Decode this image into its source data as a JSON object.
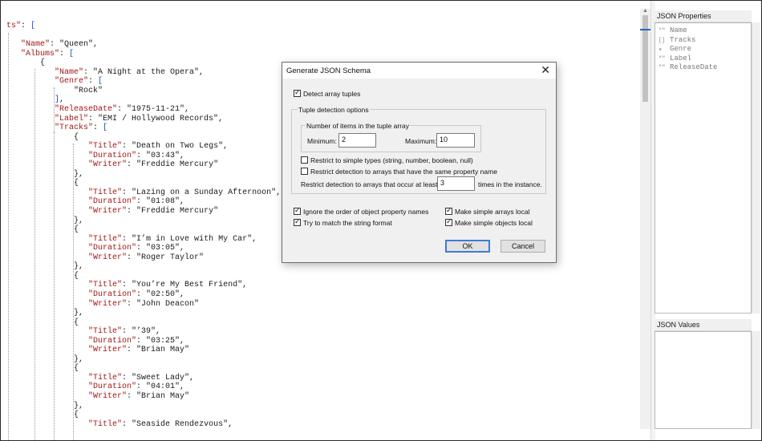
{
  "editor": {
    "lines": [
      [
        {
          "c": "k",
          "t": "ts\""
        },
        {
          "c": "p",
          "t": ": "
        },
        {
          "c": "b",
          "t": "["
        }
      ],
      [],
      [
        {
          "c": "p",
          "t": "   "
        },
        {
          "c": "k",
          "t": "\"Name\""
        },
        {
          "c": "p",
          "t": ": \"Queen\","
        }
      ],
      [
        {
          "c": "p",
          "t": "   "
        },
        {
          "c": "k",
          "t": "\"Albums\""
        },
        {
          "c": "p",
          "t": ": "
        },
        {
          "c": "b",
          "t": "["
        }
      ],
      [
        {
          "c": "p",
          "t": "       {"
        }
      ],
      [
        {
          "c": "p",
          "t": "          "
        },
        {
          "c": "k",
          "t": "\"Name\""
        },
        {
          "c": "p",
          "t": ": \"A Night at the Opera\","
        }
      ],
      [
        {
          "c": "p",
          "t": "          "
        },
        {
          "c": "k",
          "t": "\"Genre\""
        },
        {
          "c": "p",
          "t": ": "
        },
        {
          "c": "b",
          "t": "["
        }
      ],
      [
        {
          "c": "p",
          "t": "              \"Rock\""
        }
      ],
      [
        {
          "c": "p",
          "t": "          "
        },
        {
          "c": "b",
          "t": "]"
        },
        {
          "c": "p",
          "t": ","
        }
      ],
      [
        {
          "c": "p",
          "t": "          "
        },
        {
          "c": "k",
          "t": "\"ReleaseDate\""
        },
        {
          "c": "p",
          "t": ": \"1975-11-21\","
        }
      ],
      [
        {
          "c": "p",
          "t": "          "
        },
        {
          "c": "k",
          "t": "\"Label\""
        },
        {
          "c": "p",
          "t": ": \"EMI / Hollywood Records\","
        }
      ],
      [
        {
          "c": "p",
          "t": "          "
        },
        {
          "c": "k",
          "t": "\"Tracks\""
        },
        {
          "c": "p",
          "t": ": "
        },
        {
          "c": "b",
          "t": "["
        }
      ],
      [
        {
          "c": "p",
          "t": "              {"
        }
      ],
      [
        {
          "c": "p",
          "t": "                 "
        },
        {
          "c": "k",
          "t": "\"Title\""
        },
        {
          "c": "p",
          "t": ": \"Death on Two Legs\","
        }
      ],
      [
        {
          "c": "p",
          "t": "                 "
        },
        {
          "c": "k",
          "t": "\"Duration\""
        },
        {
          "c": "p",
          "t": ": \"03:43\","
        }
      ],
      [
        {
          "c": "p",
          "t": "                 "
        },
        {
          "c": "k",
          "t": "\"Writer\""
        },
        {
          "c": "p",
          "t": ": \"Freddie Mercury\""
        }
      ],
      [
        {
          "c": "p",
          "t": "              },"
        }
      ],
      [
        {
          "c": "p",
          "t": "              {"
        }
      ],
      [
        {
          "c": "p",
          "t": "                 "
        },
        {
          "c": "k",
          "t": "\"Title\""
        },
        {
          "c": "p",
          "t": ": \"Lazing on a Sunday Afternoon\","
        }
      ],
      [
        {
          "c": "p",
          "t": "                 "
        },
        {
          "c": "k",
          "t": "\"Duration\""
        },
        {
          "c": "p",
          "t": ": \"01:08\","
        }
      ],
      [
        {
          "c": "p",
          "t": "                 "
        },
        {
          "c": "k",
          "t": "\"Writer\""
        },
        {
          "c": "p",
          "t": ": \"Freddie Mercury\""
        }
      ],
      [
        {
          "c": "p",
          "t": "              },"
        }
      ],
      [
        {
          "c": "p",
          "t": "              {"
        }
      ],
      [
        {
          "c": "p",
          "t": "                 "
        },
        {
          "c": "k",
          "t": "\"Title\""
        },
        {
          "c": "p",
          "t": ": \"I’m in Love with My Car\","
        }
      ],
      [
        {
          "c": "p",
          "t": "                 "
        },
        {
          "c": "k",
          "t": "\"Duration\""
        },
        {
          "c": "p",
          "t": ": \"03:05\","
        }
      ],
      [
        {
          "c": "p",
          "t": "                 "
        },
        {
          "c": "k",
          "t": "\"Writer\""
        },
        {
          "c": "p",
          "t": ": \"Roger Taylor\""
        }
      ],
      [
        {
          "c": "p",
          "t": "              },"
        }
      ],
      [
        {
          "c": "p",
          "t": "              {"
        }
      ],
      [
        {
          "c": "p",
          "t": "                 "
        },
        {
          "c": "k",
          "t": "\"Title\""
        },
        {
          "c": "p",
          "t": ": \"You’re My Best Friend\","
        }
      ],
      [
        {
          "c": "p",
          "t": "                 "
        },
        {
          "c": "k",
          "t": "\"Duration\""
        },
        {
          "c": "p",
          "t": ": \"02:50\","
        }
      ],
      [
        {
          "c": "p",
          "t": "                 "
        },
        {
          "c": "k",
          "t": "\"Writer\""
        },
        {
          "c": "p",
          "t": ": \"John Deacon\""
        }
      ],
      [
        {
          "c": "p",
          "t": "              },"
        }
      ],
      [
        {
          "c": "p",
          "t": "              {"
        }
      ],
      [
        {
          "c": "p",
          "t": "                 "
        },
        {
          "c": "k",
          "t": "\"Title\""
        },
        {
          "c": "p",
          "t": ": \"’39\","
        }
      ],
      [
        {
          "c": "p",
          "t": "                 "
        },
        {
          "c": "k",
          "t": "\"Duration\""
        },
        {
          "c": "p",
          "t": ": \"03:25\","
        }
      ],
      [
        {
          "c": "p",
          "t": "                 "
        },
        {
          "c": "k",
          "t": "\"Writer\""
        },
        {
          "c": "p",
          "t": ": \"Brian May\""
        }
      ],
      [
        {
          "c": "p",
          "t": "              },"
        }
      ],
      [
        {
          "c": "p",
          "t": "              {"
        }
      ],
      [
        {
          "c": "p",
          "t": "                 "
        },
        {
          "c": "k",
          "t": "\"Title\""
        },
        {
          "c": "p",
          "t": ": \"Sweet Lady\","
        }
      ],
      [
        {
          "c": "p",
          "t": "                 "
        },
        {
          "c": "k",
          "t": "\"Duration\""
        },
        {
          "c": "p",
          "t": ": \"04:01\","
        }
      ],
      [
        {
          "c": "p",
          "t": "                 "
        },
        {
          "c": "k",
          "t": "\"Writer\""
        },
        {
          "c": "p",
          "t": ": \"Brian May\""
        }
      ],
      [
        {
          "c": "p",
          "t": "              },"
        }
      ],
      [
        {
          "c": "p",
          "t": "              {"
        }
      ],
      [
        {
          "c": "p",
          "t": "                 "
        },
        {
          "c": "k",
          "t": "\"Title\""
        },
        {
          "c": "p",
          "t": ": \"Seaside Rendezvous\","
        }
      ]
    ]
  },
  "json_properties": {
    "title": "JSON Properties",
    "items": [
      {
        "icon": "\"\"",
        "label": "Name"
      },
      {
        "icon": "[]",
        "label": "Tracks"
      },
      {
        "icon": "★",
        "label": "Genre"
      },
      {
        "icon": "\"\"",
        "label": "Label"
      },
      {
        "icon": "\"\"",
        "label": "ReleaseDate"
      }
    ]
  },
  "json_values": {
    "title": "JSON Values"
  },
  "dialog": {
    "title": "Generate JSON Schema",
    "close_glyph": "✕",
    "detect_array_tuples": {
      "label": "Detect array tuples",
      "checked": true
    },
    "tuple_group_title": "Tuple detection options",
    "items_group_title": "Number of items in the tuple array",
    "minimum_label": "Minimum:",
    "minimum_value": "2",
    "maximum_label": "Maximum:",
    "maximum_value": "10",
    "restrict_simple": {
      "label": "Restrict to simple types (string, number, boolean, null)",
      "checked": false
    },
    "restrict_same_name": {
      "label": "Restrict detection to arrays that have the same property name",
      "checked": false
    },
    "occur_prefix": "Restrict detection to arrays that occur at least",
    "occur_value": "3",
    "occur_suffix": "times in the instance.",
    "ignore_order": {
      "label": "Ignore the order of object property names",
      "checked": true
    },
    "match_string": {
      "label": "Try to match the string format",
      "checked": true
    },
    "arrays_local": {
      "label": "Make simple arrays local",
      "checked": true
    },
    "objects_local": {
      "label": "Make simple objects local",
      "checked": true
    },
    "ok_label": "OK",
    "cancel_label": "Cancel"
  }
}
